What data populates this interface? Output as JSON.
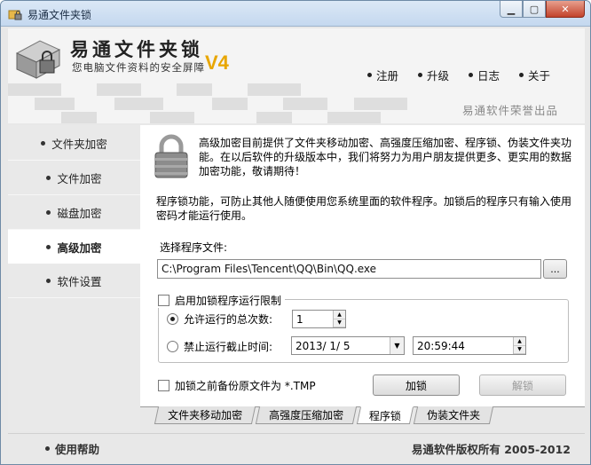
{
  "window": {
    "title": "易通文件夹锁"
  },
  "banner": {
    "title": "易通文件夹锁",
    "subtitle": "您电脑文件资料的安全屏障",
    "version": "V4",
    "publisher": "易通软件荣誉出品",
    "nav": [
      {
        "label": "注册"
      },
      {
        "label": "升级"
      },
      {
        "label": "日志"
      },
      {
        "label": "关于"
      }
    ]
  },
  "sidebar": {
    "items": [
      {
        "label": "文件夹加密"
      },
      {
        "label": "文件加密"
      },
      {
        "label": "磁盘加密"
      },
      {
        "label": "高级加密"
      },
      {
        "label": "软件设置"
      }
    ]
  },
  "content": {
    "desc1": "高级加密目前提供了文件夹移动加密、高强度压缩加密、程序锁、伪装文件夹功能。在以后软件的升级版本中，我们将努力为用户朋友提供更多、更实用的数据加密功能，敬请期待！",
    "desc2": "程序锁功能，可防止其他人随便使用您系统里面的软件程序。加锁后的程序只有输入使用密码才能运行使用。",
    "select_label": "选择程序文件:",
    "path_value": "C:\\Program Files\\Tencent\\QQ\\Bin\\QQ.exe",
    "browse_label": "...",
    "limit_label": "启用加锁程序运行限制",
    "count_label": "允许运行的总次数:",
    "count_value": "1",
    "deadline_label": "禁止运行截止时间:",
    "date_value": "2013/  1/  5",
    "time_value": "20:59:44",
    "backup_label": "加锁之前备份原文件为 *.TMP",
    "lock_button": "加锁",
    "unlock_button": "解锁"
  },
  "tabs": [
    {
      "label": "文件夹移动加密"
    },
    {
      "label": "高强度压缩加密"
    },
    {
      "label": "程序锁"
    },
    {
      "label": "伪装文件夹"
    }
  ],
  "footer": {
    "help": "使用帮助",
    "copyright": "易通软件版权所有 2005-2012"
  },
  "colors": {
    "version_accent": "#e8a600",
    "close_button": "#c2432c"
  }
}
